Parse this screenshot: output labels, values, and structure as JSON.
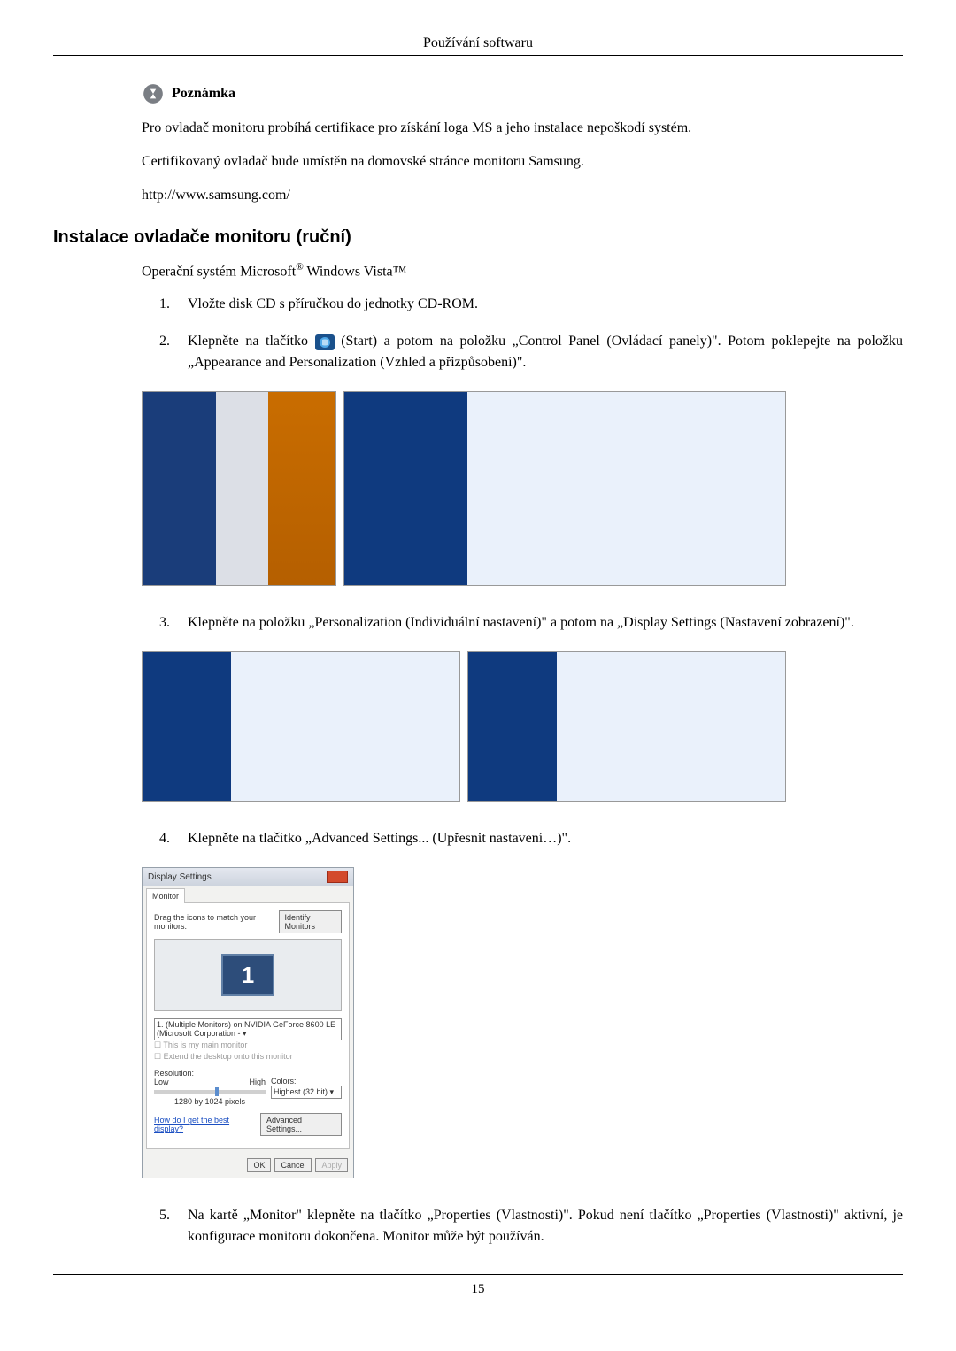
{
  "header": {
    "title": "Používání softwaru"
  },
  "note": {
    "label": "Poznámka",
    "p1": "Pro ovladač monitoru probíhá certifikace pro získání loga MS a jeho instalace nepoškodí systém.",
    "p2": "Certifikovaný ovladač bude umístěn na domovské stránce monitoru Samsung.",
    "p3": "http://www.samsung.com/"
  },
  "section": {
    "title": "Instalace ovladače monitoru (ruční)",
    "intro_pre": "Operační systém Microsoft",
    "intro_reg": "®",
    "intro_mid": " Windows Vista",
    "intro_tm": "™"
  },
  "steps": {
    "s1_num": "1.",
    "s1": "Vložte disk CD s příručkou do jednotky CD-ROM.",
    "s2_num": "2.",
    "s2_a": "Klepněte na tlačítko ",
    "s2_b": "(Start) a potom na položku „Control Panel (Ovládací panely)\". Potom poklepejte na položku „Appearance and Personalization (Vzhled a přizpůsobení)\".",
    "s3_num": "3.",
    "s3": "Klepněte na položku „Personalization (Individuální nastavení)\" a potom na „Display Settings (Nastavení zobrazení)\".",
    "s4_num": "4.",
    "s4": "Klepněte na tlačítko „Advanced Settings... (Upřesnit nastavení…)\".",
    "s5_num": "5.",
    "s5": "Na kartě „Monitor\" klepněte na tlačítko „Properties (Vlastnosti)\". Pokud není tlačítko „Properties (Vlastnosti)\" aktivní, je konfigurace monitoru dokončena. Monitor může být používán."
  },
  "display_settings": {
    "title": "Display Settings",
    "tab": "Monitor",
    "drag_text": "Drag the icons to match your monitors.",
    "identify_btn": "Identify Monitors",
    "monitor_num": "1",
    "selector": "1. (Multiple Monitors) on NVIDIA GeForce 8600 LE (Microsoft Corporation - ▾",
    "check1": "☐ This is my main monitor",
    "check2": "☐ Extend the desktop onto this monitor",
    "res_label": "Resolution:",
    "low": "Low",
    "high": "High",
    "res_value": "1280 by 1024 pixels",
    "colors_label": "Colors:",
    "colors_value": "Highest (32 bit)   ▾",
    "help_link": "How do I get the best display?",
    "adv_btn": "Advanced Settings...",
    "ok": "OK",
    "cancel": "Cancel",
    "apply": "Apply"
  },
  "footer": {
    "page": "15"
  }
}
